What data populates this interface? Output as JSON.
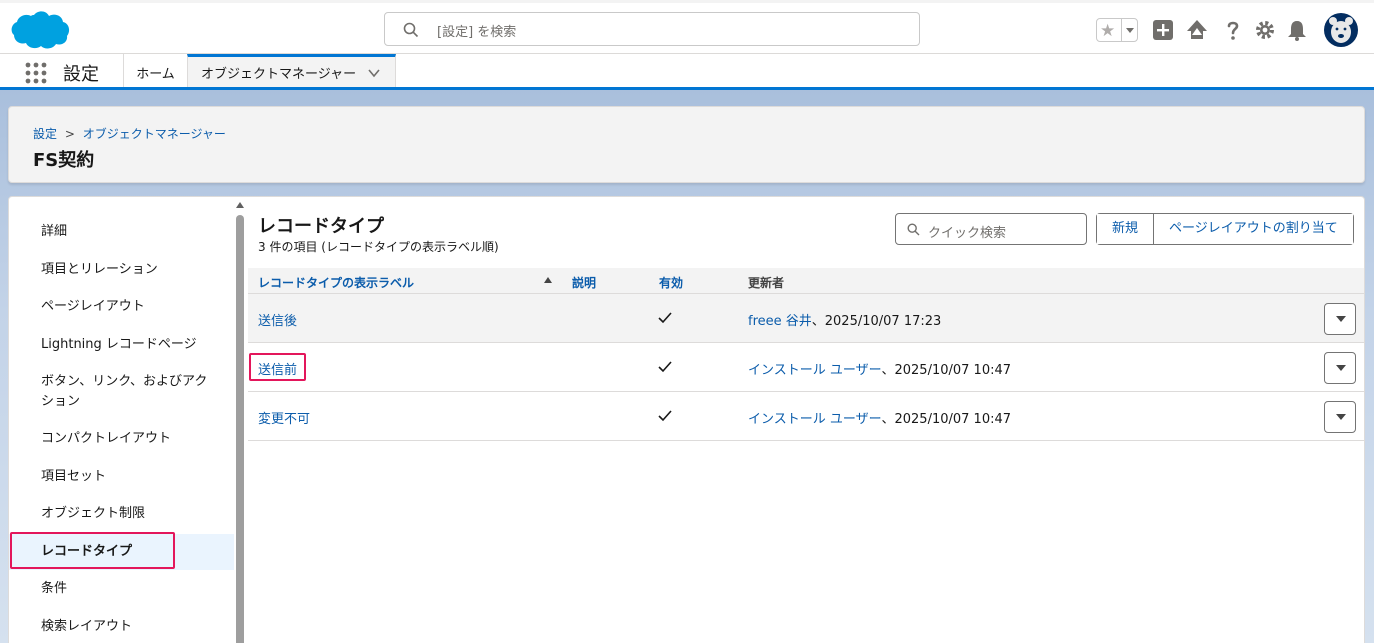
{
  "header": {
    "search_placeholder": "[設定] を検索",
    "app_name": "設定",
    "tabs": [
      {
        "label": "ホーム"
      },
      {
        "label": "オブジェクトマネージャー"
      }
    ]
  },
  "page": {
    "breadcrumb": [
      "設定",
      "オブジェクトマネージャー"
    ],
    "breadcrumb_separator": ">",
    "title": "FS契約"
  },
  "sidebar": {
    "items": [
      {
        "label": "詳細"
      },
      {
        "label": "項目とリレーション"
      },
      {
        "label": "ページレイアウト"
      },
      {
        "label": "Lightning レコードページ"
      },
      {
        "label": "ボタン、リンク、およびアク"
      },
      {
        "label": "ション"
      },
      {
        "label": "コンパクトレイアウト"
      },
      {
        "label": "項目セット"
      },
      {
        "label": "オブジェクト制限"
      },
      {
        "label": "レコードタイプ"
      },
      {
        "label": "条件"
      },
      {
        "label": "検索レイアウト"
      }
    ],
    "active_index": 9
  },
  "section": {
    "title": "レコードタイプ",
    "subtitle": "3 件の項目 (レコードタイプの表示ラベル順)",
    "quick_search_placeholder": "クイック検索",
    "new_button": "新規",
    "assign_layout_button": "ページレイアウトの割り当て"
  },
  "table": {
    "columns": [
      "レコードタイプの表示ラベル",
      "説明",
      "有効",
      "更新者"
    ],
    "rows": [
      {
        "label": "送信後",
        "description": "",
        "active": true,
        "modified_by": "freee 谷井",
        "modified_at": "、2025/10/07 17:23"
      },
      {
        "label": "送信前",
        "description": "",
        "active": true,
        "modified_by": "インストール ユーザー",
        "modified_at": "、2025/10/07 10:47"
      },
      {
        "label": "変更不可",
        "description": "",
        "active": true,
        "modified_by": "インストール ユーザー",
        "modified_at": "、2025/10/07 10:47"
      }
    ]
  },
  "colors": {
    "brand": "#0176d3",
    "link": "#0b5cab",
    "highlight": "#e3165b"
  }
}
